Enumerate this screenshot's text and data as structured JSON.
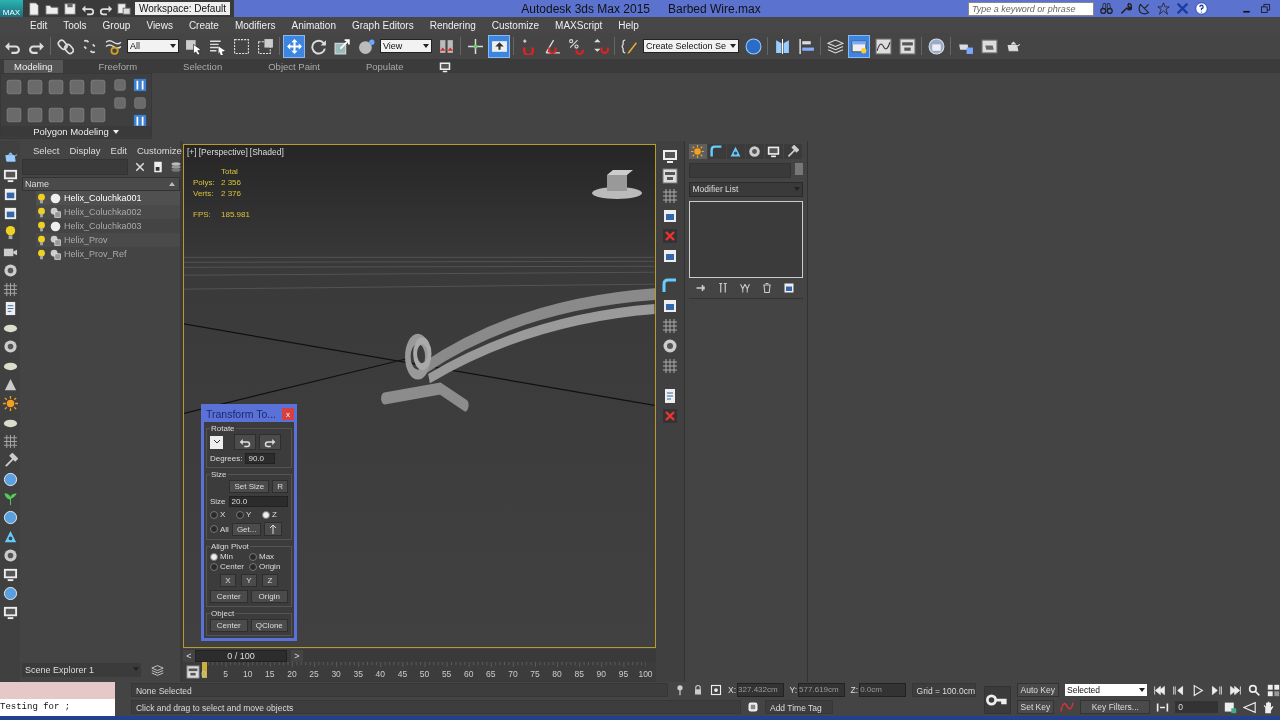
{
  "title_bar": {
    "app_button_label": "MAX",
    "workspace": "Workspace: Default",
    "app_title": "Autodesk 3ds Max  2015",
    "file_name": "Barbed Wire.max",
    "search": {
      "placeholder": "Type a keyword or phrase"
    }
  },
  "menu": [
    "Edit",
    "Tools",
    "Group",
    "Views",
    "Create",
    "Modifiers",
    "Animation",
    "Graph Editors",
    "Rendering",
    "Customize",
    "MAXScript",
    "Help"
  ],
  "main_toolbar": {
    "selection_filter": "All",
    "reference_coord": "View",
    "named_selection": "Create Selection Se",
    "tools": [
      {
        "selected": false
      },
      {
        "selected": false
      },
      {
        "selected": false
      },
      {
        "selected": false
      },
      {
        "selected": false
      },
      {
        "selected": false
      },
      {
        "selected": false
      },
      {
        "selected": false
      },
      {
        "selected": false
      },
      {
        "selected": true
      },
      {
        "selected": false
      },
      {
        "selected": false
      },
      {
        "selected": false
      },
      {
        "selected": false
      },
      {
        "selected": false
      },
      {
        "selected": true
      },
      {
        "selected": false
      },
      {
        "selected": false
      },
      {
        "selected": false
      },
      {
        "selected": false
      },
      {
        "selected": false
      },
      {
        "selected": false
      },
      {
        "selected": false
      },
      {
        "selected": false
      },
      {
        "selected": false
      },
      {
        "selected": true
      },
      {
        "selected": false
      },
      {
        "selected": false
      },
      {
        "selected": false
      },
      {
        "selected": false
      },
      {
        "selected": false
      },
      {
        "selected": false
      }
    ]
  },
  "ribbon": {
    "tabs": [
      {
        "label": "Modeling",
        "selected": true
      },
      {
        "label": "Freeform",
        "selected": false
      },
      {
        "label": "Selection",
        "selected": false
      },
      {
        "label": "Object Paint",
        "selected": false
      },
      {
        "label": "Populate",
        "selected": false
      }
    ],
    "panel_label": "Polygon Modeling"
  },
  "scene_explorer": {
    "menu": [
      "Select",
      "Display",
      "Edit",
      "Customize"
    ],
    "column": "Name",
    "items": [
      {
        "name": "Helix_Coluchka001",
        "kind": "geometry",
        "selected": true
      },
      {
        "name": "Helix_Coluchka002",
        "kind": "shape",
        "selected": false
      },
      {
        "name": "Helix_Coluchka003",
        "kind": "geometry",
        "selected": false
      },
      {
        "name": "Helix_Prov",
        "kind": "shape",
        "selected": false
      },
      {
        "name": "Helix_Prov_Ref",
        "kind": "shape",
        "selected": false
      }
    ],
    "explorer_name": "Scene Explorer 1"
  },
  "viewport": {
    "labels": [
      "[+]",
      "[Perspective]",
      "[Shaded]"
    ],
    "stats": {
      "heading": "Total",
      "rows": [
        {
          "label": "Polys:",
          "value": "2 356"
        },
        {
          "label": "Verts:",
          "value": "2 376"
        }
      ],
      "fps_label": "FPS:",
      "fps": "185.981"
    }
  },
  "transform_dialog": {
    "title": "Transform To...",
    "close": "x",
    "rotate": {
      "label": "Rotate",
      "degrees_label": "Degrees:",
      "degrees": "90.0"
    },
    "size": {
      "label": "Size",
      "set_size": "Set Size",
      "reset": "R",
      "size_label": "Size",
      "size": "20.0",
      "axes": [
        {
          "label": "X",
          "selected": false
        },
        {
          "label": "Y",
          "selected": false
        },
        {
          "label": "Z",
          "selected": true
        },
        {
          "label": "All",
          "selected": false
        }
      ],
      "get": "Get..."
    },
    "align_pivot": {
      "label": "Align Pivot",
      "options": [
        {
          "label": "Min",
          "selected": true
        },
        {
          "label": "Max",
          "selected": false
        },
        {
          "label": "Center",
          "selected": false
        },
        {
          "label": "Origin",
          "selected": false
        }
      ],
      "axis_buttons": [
        "X",
        "Y",
        "Z"
      ],
      "buttons": [
        "Center",
        "Origin"
      ]
    },
    "object": {
      "label": "Object",
      "buttons": [
        "Center",
        "QClone"
      ]
    }
  },
  "command_panel": {
    "tabs": [
      {
        "selected": true
      },
      {
        "selected": false
      },
      {
        "selected": false
      },
      {
        "selected": false
      },
      {
        "selected": false
      },
      {
        "selected": false
      }
    ],
    "modifier_list": "Modifier List"
  },
  "time_slider": {
    "prev": "<",
    "position": "0 / 100",
    "next": ">",
    "level": 0
  },
  "track_bar": {
    "ticks": [
      "0",
      "5",
      "10",
      "15",
      "20",
      "25",
      "30",
      "35",
      "40",
      "45",
      "50",
      "55",
      "60",
      "65",
      "70",
      "75",
      "80",
      "85",
      "90",
      "95",
      "100"
    ]
  },
  "status": {
    "listener": "Testing for ;",
    "selection": "None Selected",
    "prompt": "Click and drag to select and move objects",
    "x_label": "X:",
    "x": "327.432cm",
    "y_label": "Y:",
    "y": "577.619cm",
    "z_label": "Z:",
    "z": "0.0cm",
    "grid": "Grid = 100.0cm",
    "add_time_tag": "Add Time Tag"
  },
  "animation": {
    "auto_key": "Auto Key",
    "key_mode": "Selected",
    "set_key": "Set Key",
    "key_filters": "Key Filters...",
    "frame": "0"
  }
}
